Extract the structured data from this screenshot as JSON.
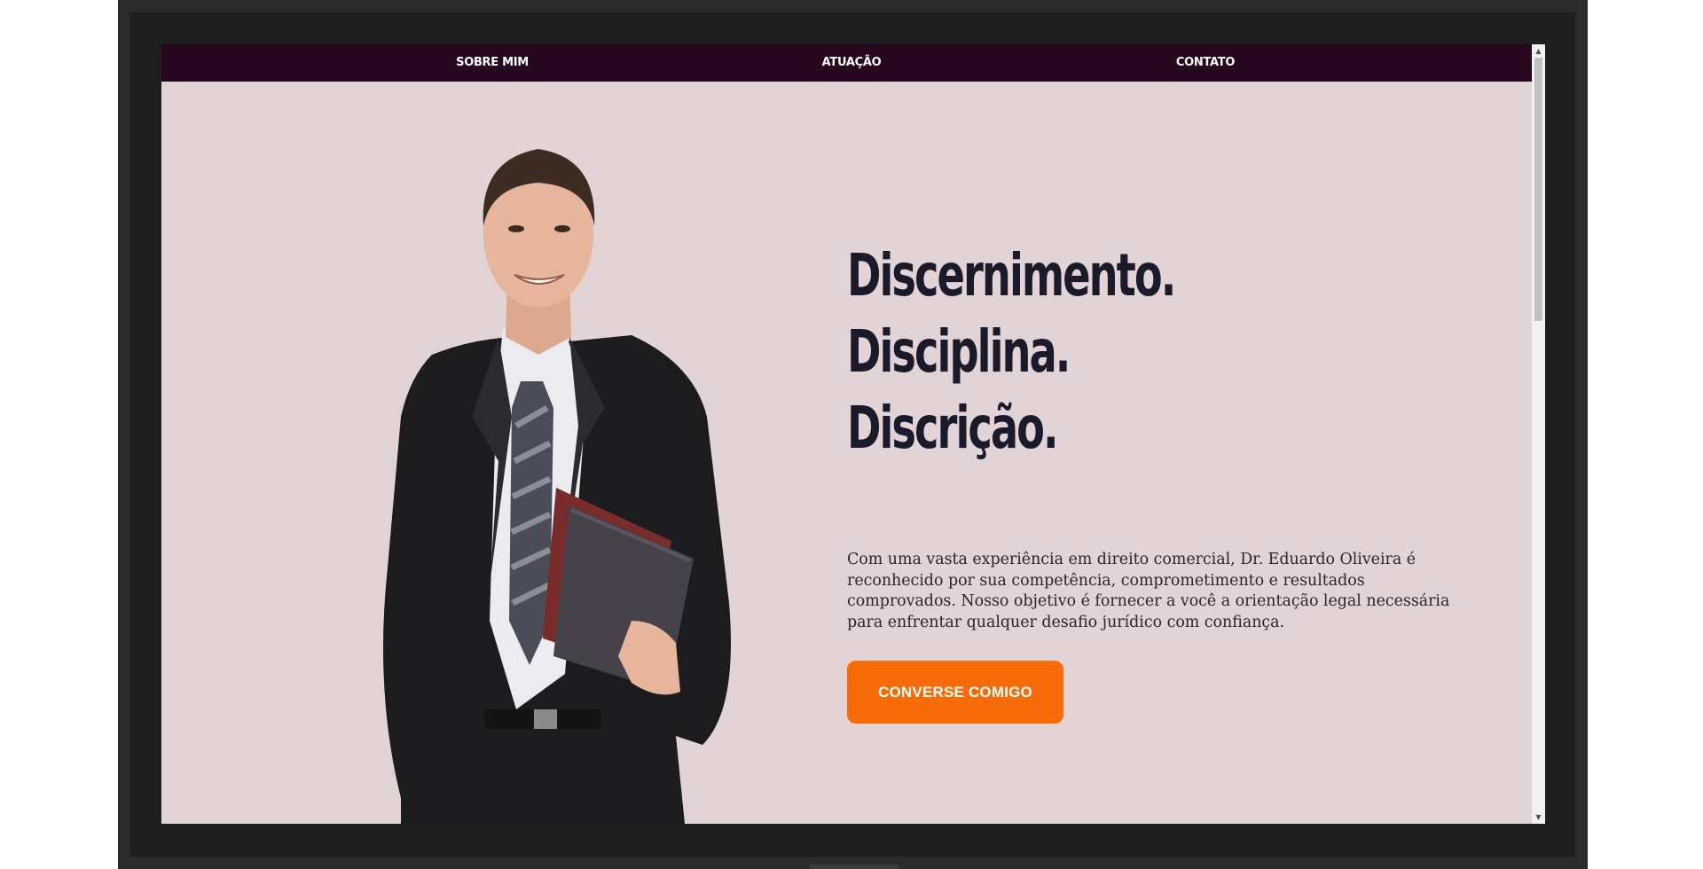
{
  "nav": {
    "items": [
      {
        "label": "SOBRE MIM"
      },
      {
        "label": "ATUAÇÃO"
      },
      {
        "label": "CONTATO"
      }
    ]
  },
  "hero": {
    "headline": [
      "Discernimento.",
      "Disciplina.",
      "Discrição."
    ],
    "intro": "Com uma vasta experiência em direito comercial, Dr. Eduardo Oliveira é reconhecido por sua competência, comprometimento e resultados comprovados. Nosso objetivo é fornecer a você a orientação legal necessária para enfrentar qualquer desafio jurídico com confiança.",
    "cta_label": "CONVERSE COMIGO",
    "photo_icon": "businessman-photo"
  },
  "colors": {
    "nav_bg": "#270720",
    "page_bg": "#e2d4d6",
    "cta_bg": "#f76b08",
    "headline": "#1a1a2a"
  }
}
